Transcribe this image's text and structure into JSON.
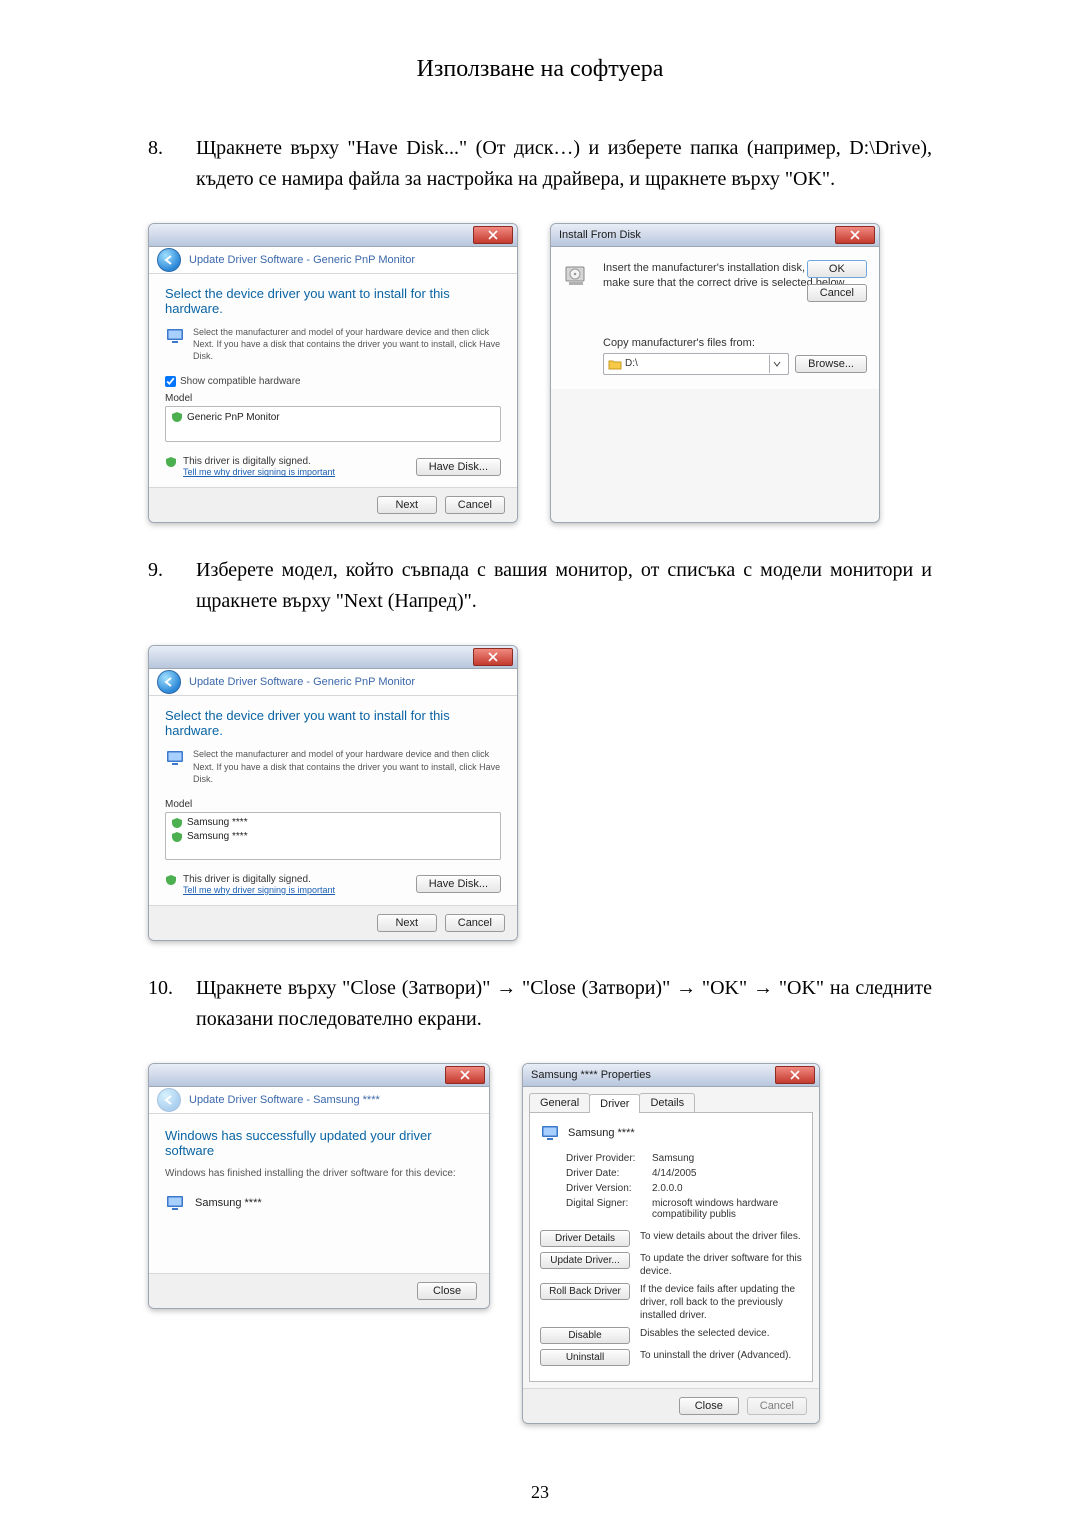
{
  "page_title": "Използване на софтуера",
  "page_number": "23",
  "steps": {
    "s8": {
      "num": "8.",
      "text": "Щракнете върху \"Have Disk...\" (От диск…) и изберете папка (например, D:\\Drive), където се намира файла за настройка на драйвера, и щракнете върху \"OK\"."
    },
    "s9": {
      "num": "9.",
      "text": "Изберете модел, който съвпада с вашия монитор, от списъка с модели монитори и щракнете върху \"Next (Напред)\"."
    },
    "s10": {
      "num": "10.",
      "text": "Щракнете върху \"Close (Затвори)\" → \"Close (Затвори)\" → \"OK\" → \"OK\" на следните показани последователно екрани."
    }
  },
  "dlg8a": {
    "crumb": "Update Driver Software - Generic PnP Monitor",
    "heading": "Select the device driver you want to install for this hardware.",
    "instr": "Select the manufacturer and model of your hardware device and then click Next. If you have a disk that contains the driver you want to install, click Have Disk.",
    "chk": "Show compatible hardware",
    "model_hdr": "Model",
    "model_item": "Generic PnP Monitor",
    "signed1": "This driver is digitally signed.",
    "signed2": "Tell me why driver signing is important",
    "have_disk": "Have Disk...",
    "next": "Next",
    "cancel": "Cancel"
  },
  "dlg8b": {
    "title": "Install From Disk",
    "msg": "Insert the manufacturer's installation disk, and then make sure that the correct drive is selected below.",
    "ok": "OK",
    "cancel": "Cancel",
    "copy_label": "Copy manufacturer's files from:",
    "path": "D:\\",
    "browse": "Browse..."
  },
  "dlg9": {
    "crumb": "Update Driver Software - Generic PnP Monitor",
    "heading": "Select the device driver you want to install for this hardware.",
    "instr": "Select the manufacturer and model of your hardware device and then click Next. If you have a disk that contains the driver you want to install, click Have Disk.",
    "model_hdr": "Model",
    "model_item1": "Samsung ****",
    "model_item2": "Samsung ****",
    "signed1": "This driver is digitally signed.",
    "signed2": "Tell me why driver signing is important",
    "have_disk": "Have Disk...",
    "next": "Next",
    "cancel": "Cancel"
  },
  "dlg10a": {
    "crumb": "Update Driver Software - Samsung ****",
    "heading": "Windows has successfully updated your driver software",
    "sub": "Windows has finished installing the driver software for this device:",
    "device": "Samsung ****",
    "close": "Close"
  },
  "dlg10b": {
    "title": "Samsung **** Properties",
    "tabs": {
      "general": "General",
      "driver": "Driver",
      "details": "Details"
    },
    "device": "Samsung ****",
    "kv": {
      "provider_k": "Driver Provider:",
      "provider_v": "Samsung",
      "date_k": "Driver Date:",
      "date_v": "4/14/2005",
      "version_k": "Driver Version:",
      "version_v": "2.0.0.0",
      "signer_k": "Digital Signer:",
      "signer_v": "microsoft windows hardware compatibility publis"
    },
    "actions": {
      "details": "Driver Details",
      "details_d": "To view details about the driver files.",
      "update": "Update Driver...",
      "update_d": "To update the driver software for this device.",
      "rollback": "Roll Back Driver",
      "rollback_d": "If the device fails after updating the driver, roll back to the previously installed driver.",
      "disable": "Disable",
      "disable_d": "Disables the selected device.",
      "uninstall": "Uninstall",
      "uninstall_d": "To uninstall the driver (Advanced)."
    },
    "close": "Close",
    "cancel": "Cancel"
  }
}
